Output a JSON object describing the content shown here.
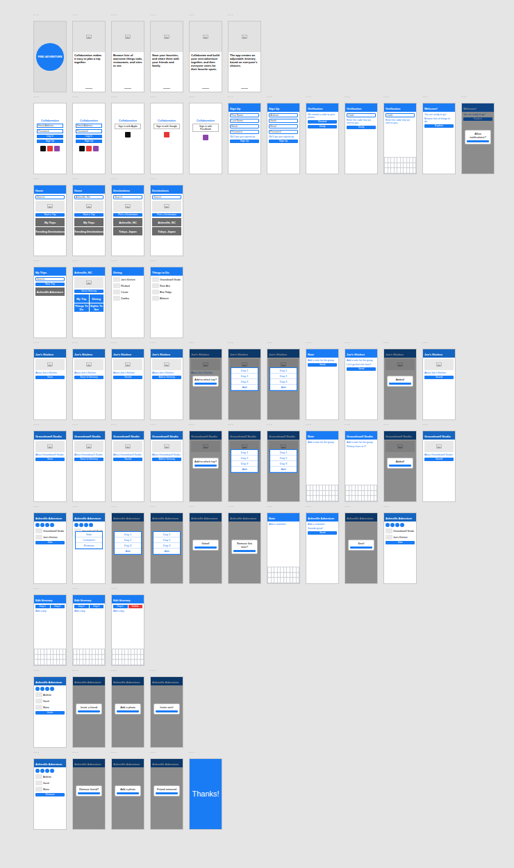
{
  "frame_label": "...",
  "rows": [
    [
      {
        "kind": "splash",
        "texts": [
          "FIND ADVENTURE"
        ]
      },
      {
        "kind": "onboard",
        "texts": [
          "Collaboration makes it easy to plan a trip together."
        ]
      },
      {
        "kind": "onboard",
        "texts": [
          "Browse lists of awesome things todo, restaurants, and sites to see."
        ]
      },
      {
        "kind": "onboard",
        "texts": [
          "Save your favorites, and share them with your friends and family."
        ]
      },
      {
        "kind": "onboard",
        "texts": [
          "Collaborate and build your next adventure together, and then everyone votes for their favorite spots."
        ]
      },
      {
        "kind": "onboard",
        "texts": [
          "The app creates an adjustable itinerary based on everyone's choices."
        ]
      }
    ],
    [
      {
        "kind": "login",
        "title": "Collaboration",
        "fields": [
          "Email Address",
          "Password"
        ],
        "buttons": [
          "Log In",
          "Sign Up"
        ],
        "social": [
          "#111111",
          "#e53935",
          "#8e44ad"
        ]
      },
      {
        "kind": "login",
        "title": "Collaboration",
        "fields": [
          "Email Address",
          "Password"
        ],
        "buttons": [
          "Log In",
          "Sign Up"
        ],
        "social": [
          "#111111",
          "#e53935",
          "#8e44ad"
        ]
      },
      {
        "kind": "login",
        "title": "Collaboration",
        "dialog": "Sign in with Apple",
        "social": [
          "#111111"
        ]
      },
      {
        "kind": "login",
        "title": "Collaboration",
        "dialog": "Sign in with Google",
        "social": [
          "#e53935"
        ]
      },
      {
        "kind": "login",
        "title": "Collaboration",
        "dialog": "Sign in with Facebook",
        "social": [
          "#8e44ad"
        ]
      },
      {
        "kind": "screen",
        "title": "Sign Up",
        "lines": [
          "We'll get you signed up."
        ],
        "fields": [
          "First Name",
          "Last Name",
          "Email",
          "Password"
        ],
        "buttons": [
          "Sign Up"
        ]
      },
      {
        "kind": "screen",
        "title": "Sign Up",
        "lines": [
          "We'll get you signed up."
        ],
        "fields": [
          "Andrew",
          "Smith",
          "Email",
          "Password"
        ],
        "buttons": [
          "Sign Up"
        ]
      },
      {
        "kind": "screen",
        "title": "Verification",
        "lines": [
          "We texted a code to your phone."
        ],
        "buttons": [
          "Resend",
          "Verify"
        ]
      },
      {
        "kind": "screen",
        "title": "Verification",
        "lines": [
          "Enter the code that we sent to you."
        ],
        "fields": [
          "Code"
        ],
        "buttons": [
          "Verify"
        ]
      },
      {
        "kind": "screen",
        "title": "Verification",
        "lines": [
          "Enter the code that we sent to you."
        ],
        "fields": [
          "Code"
        ],
        "keyboard": true
      },
      {
        "kind": "screen",
        "title": "Welcome!",
        "lines": [
          "You are ready to go!",
          "Browse lists of things to do."
        ],
        "buttons": [
          "Explore"
        ]
      },
      {
        "kind": "screen",
        "title": "Welcome!",
        "lines": [
          "You are ready to go!"
        ],
        "buttons": [
          "Explore"
        ],
        "dim": true,
        "dialog": "Allow notifications?"
      }
    ],
    [
      {
        "kind": "screen",
        "title": "Home",
        "fields": [
          "Search"
        ],
        "image": true,
        "buttons": [
          "Start a Trip"
        ],
        "tiles": [
          "My Trips",
          "Trending Destinations"
        ]
      },
      {
        "kind": "screen",
        "title": "Home",
        "fields": [
          "Asheville, NC"
        ],
        "image": true,
        "buttons": [
          "Start a Trip"
        ],
        "tiles": [
          "My Trips",
          "Trending Destinations"
        ]
      },
      {
        "kind": "screen",
        "title": "Destinations",
        "fields": [
          "Search"
        ],
        "image": true,
        "buttons": [
          "Pick a Destination"
        ],
        "tiles": [
          "Asheville, NC",
          "Tokyo, Japan"
        ]
      },
      {
        "kind": "screen",
        "title": "Destinations",
        "fields": [
          "Search"
        ],
        "image": true,
        "buttons": [
          "Pick a Destination"
        ],
        "tiles": [
          "Asheville, NC",
          "Tokyo, Japan"
        ]
      }
    ],
    [
      {
        "kind": "screen",
        "title": "My Trips",
        "fields": [
          "Search"
        ],
        "buttons": [
          "New Trip"
        ],
        "tiles": [
          "Asheville Adventure"
        ]
      },
      {
        "kind": "screen",
        "title": "Asheville, NC",
        "image": true,
        "buttons": [
          "Go to Itinerary"
        ],
        "tiles": [
          "My Trip",
          "Dining",
          "Things To Do",
          "Sights To See"
        ]
      },
      {
        "kind": "screen",
        "title": "Dining",
        "list": [
          "Joe's Kitchen",
          "Rhubarb",
          "Cúrate",
          "Zambra"
        ]
      },
      {
        "kind": "screen",
        "title": "Things to Do",
        "list": [
          "Groundswell Studio",
          "River Arts",
          "Blue Ridge",
          "Biltmore"
        ]
      }
    ],
    [
      {
        "kind": "screen",
        "title": "Joe's Kitchen",
        "dark": true,
        "image": true,
        "lines": [
          "About Joe's Kitchen"
        ],
        "buttons": [
          "Save"
        ]
      },
      {
        "kind": "screen",
        "title": "Joe's Kitchen",
        "dark": true,
        "image": true,
        "lines": [
          "About Joe's Kitchen"
        ],
        "buttons": [
          "Save to Itinerary"
        ]
      },
      {
        "kind": "screen",
        "title": "Joe's Kitchen",
        "dark": true,
        "image": true,
        "lines": [
          "About Joe's Kitchen"
        ],
        "buttons": [
          "Saved"
        ]
      },
      {
        "kind": "screen",
        "title": "Joe's Kitchen",
        "dark": true,
        "image": true,
        "lines": [
          "About Joe's Kitchen"
        ],
        "buttons": [
          "Add to Itinerary"
        ]
      },
      {
        "kind": "screen",
        "title": "Joe's Kitchen",
        "dark": true,
        "image": true,
        "lines": [
          "About Joe's Kitchen"
        ],
        "dim": true,
        "dialog": "Add to which trip?"
      },
      {
        "kind": "screen",
        "title": "Joe's Kitchen",
        "dark": true,
        "image": true,
        "dim": true,
        "menu": [
          "Day 1",
          "Day 2",
          "Day 3",
          "Add"
        ]
      },
      {
        "kind": "screen",
        "title": "Joe's Kitchen",
        "dark": true,
        "image": true,
        "dim": true,
        "menu": [
          "Day 1",
          "Day 2",
          "Day 3",
          "Add"
        ]
      },
      {
        "kind": "screen",
        "title": "Note",
        "lines": [
          "Add a note for the group"
        ],
        "buttons": [
          "Send"
        ]
      },
      {
        "kind": "screen",
        "title": "Joe's Kitchen",
        "lines": [
          "Add a note for the group",
          "Let's go here for lunch!"
        ],
        "buttons": [
          "Send"
        ]
      },
      {
        "kind": "screen",
        "title": "Joe's Kitchen",
        "dark": true,
        "image": true,
        "dim": true,
        "dialog": "Added!"
      },
      {
        "kind": "screen",
        "title": "Joe's Kitchen",
        "dark": true,
        "image": true,
        "lines": [
          "About Joe's Kitchen"
        ],
        "buttons": [
          "Saved"
        ]
      }
    ],
    [
      {
        "kind": "screen",
        "title": "Groundswell Studio",
        "dark": true,
        "image": true,
        "lines": [
          "About Groundswell Studio"
        ],
        "buttons": [
          "Save"
        ]
      },
      {
        "kind": "screen",
        "title": "Groundswell Studio",
        "dark": true,
        "image": true,
        "lines": [
          "About Groundswell Studio"
        ],
        "buttons": [
          "Save to Itinerary"
        ]
      },
      {
        "kind": "screen",
        "title": "Groundswell Studio",
        "dark": true,
        "image": true,
        "lines": [
          "About Groundswell Studio"
        ],
        "buttons": [
          "Saved"
        ]
      },
      {
        "kind": "screen",
        "title": "Groundswell Studio",
        "dark": true,
        "image": true,
        "lines": [
          "About Groundswell Studio"
        ],
        "buttons": [
          "Add to Itinerary"
        ]
      },
      {
        "kind": "screen",
        "title": "Groundswell Studio",
        "dark": true,
        "image": true,
        "dim": true,
        "dialog": "Add to which trip?"
      },
      {
        "kind": "screen",
        "title": "Groundswell Studio",
        "dark": true,
        "image": true,
        "dim": true,
        "menu": [
          "Day 1",
          "Day 2",
          "Day 3",
          "Add"
        ]
      },
      {
        "kind": "screen",
        "title": "Groundswell Studio",
        "dark": true,
        "image": true,
        "dim": true,
        "menu": [
          "Day 1",
          "Day 2",
          "Day 3",
          "Add"
        ]
      },
      {
        "kind": "screen",
        "title": "Note",
        "lines": [
          "Add a note for the group"
        ],
        "keyboard": true
      },
      {
        "kind": "screen",
        "title": "Groundswell Studio",
        "lines": [
          "Add a note for the group",
          "Pottery class at 2!"
        ],
        "keyboard": true
      },
      {
        "kind": "screen",
        "title": "Groundswell Studio",
        "dark": true,
        "image": true,
        "dim": true,
        "dialog": "Added!"
      },
      {
        "kind": "screen",
        "title": "Groundswell Studio",
        "dark": true,
        "image": true,
        "lines": [
          "About Groundswell Studio"
        ],
        "buttons": [
          "Saved"
        ]
      }
    ],
    [
      {
        "kind": "screen",
        "title": "Asheville Adventure",
        "dark": true,
        "members": 4,
        "list": [
          "Groundswell Studio",
          "Joe's Kitchen"
        ],
        "buttons": [
          "Vote"
        ]
      },
      {
        "kind": "screen",
        "title": "Asheville Adventure",
        "dark": true,
        "members": 4,
        "list": [
          "Groundswell Studio",
          "Joe's Kitchen"
        ],
        "menu": [
          "Vote",
          "Comment",
          "Remove"
        ]
      },
      {
        "kind": "screen",
        "title": "Asheville Adventure",
        "dark": true,
        "dim": true,
        "menu": [
          "Day 1",
          "Day 2",
          "Day 3",
          "Add"
        ]
      },
      {
        "kind": "screen",
        "title": "Asheville Adventure",
        "dark": true,
        "dim": true,
        "menu": [
          "Day 1",
          "Day 2",
          "Day 3",
          "Add"
        ]
      },
      {
        "kind": "screen",
        "title": "Asheville Adventure",
        "dark": true,
        "dim": true,
        "dialog": "Voted!"
      },
      {
        "kind": "screen",
        "title": "Asheville Adventure",
        "dark": true,
        "dim": true,
        "dialog": "Remove this item?"
      },
      {
        "kind": "screen",
        "title": "Note",
        "lines": [
          "Add a comment"
        ],
        "keyboard": true
      },
      {
        "kind": "screen",
        "title": "Asheville Adventure",
        "lines": [
          "Add a comment",
          "Sounds great!"
        ],
        "buttons": [
          "Send"
        ]
      },
      {
        "kind": "screen",
        "title": "Asheville Adventure",
        "dark": true,
        "dim": true,
        "dialog": "Sent!"
      },
      {
        "kind": "screen",
        "title": "Asheville Adventure",
        "dark": true,
        "members": 4,
        "list": [
          "Groundswell Studio",
          "Joe's Kitchen"
        ],
        "buttons": [
          "Vote"
        ]
      }
    ],
    [
      {
        "kind": "screen",
        "title": "Edit Itinerary",
        "tabs": [
          "Day 1",
          "Day 2"
        ],
        "lines": [
          "Add a day"
        ],
        "keyboard": true
      },
      {
        "kind": "screen",
        "title": "Edit Itinerary",
        "tabs": [
          "Day 1",
          "Day 2"
        ],
        "lines": [
          "Add a day"
        ],
        "keyboard": true
      },
      {
        "kind": "screen",
        "title": "Edit Itinerary",
        "tabs": [
          "Day 1",
          "Delete"
        ],
        "lines": [
          "Add a day"
        ],
        "keyboard": true
      }
    ],
    [
      {
        "kind": "screen",
        "title": "Asheville Adventure",
        "dark": true,
        "members": 4,
        "list": [
          "Andrew",
          "Sarah",
          "Maria"
        ],
        "buttons": [
          "Invite"
        ]
      },
      {
        "kind": "screen",
        "title": "Asheville Adventure",
        "dark": true,
        "dim": true,
        "dialog": "Invite a friend"
      },
      {
        "kind": "screen",
        "title": "Asheville Adventure",
        "dark": true,
        "dim": true,
        "dialog": "Add a photo"
      },
      {
        "kind": "screen",
        "title": "Asheville Adventure",
        "dark": true,
        "dim": true,
        "dialog": "Invite sent!"
      }
    ],
    [
      {
        "kind": "screen",
        "title": "Asheville Adventure",
        "dark": true,
        "members": 4,
        "list": [
          "Andrew",
          "Sarah",
          "Maria"
        ],
        "buttons": [
          "Remove"
        ]
      },
      {
        "kind": "screen",
        "title": "Asheville Adventure",
        "dark": true,
        "dim": true,
        "dialog": "Remove friend?"
      },
      {
        "kind": "screen",
        "title": "Asheville Adventure",
        "dark": true,
        "dim": true,
        "dialog": "Add a photo"
      },
      {
        "kind": "screen",
        "title": "Asheville Adventure",
        "dark": true,
        "dim": true,
        "dialog": "Friend removed"
      },
      {
        "kind": "thanks",
        "texts": [
          "Thanks!"
        ]
      }
    ]
  ]
}
